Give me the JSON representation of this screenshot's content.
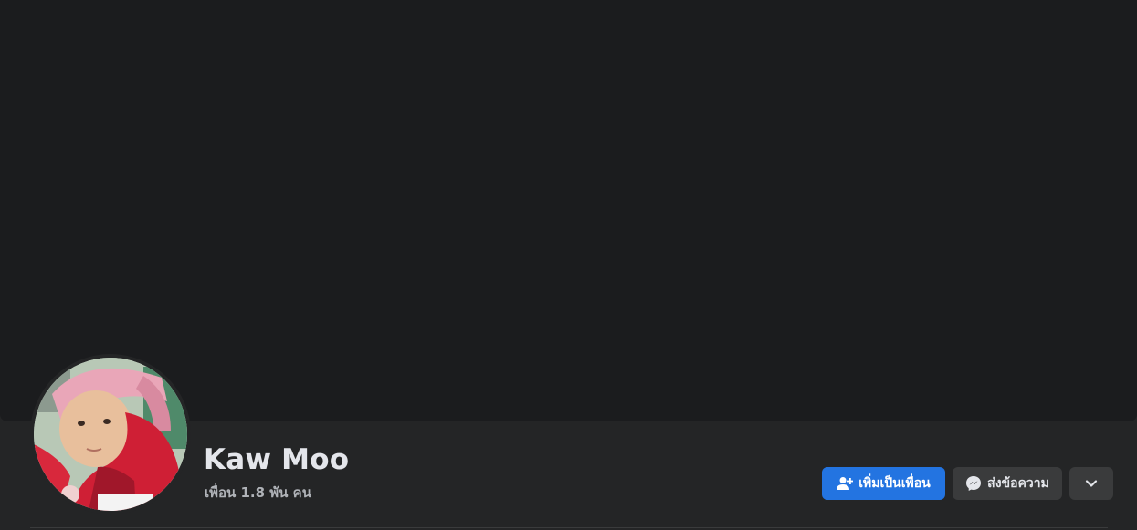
{
  "profile": {
    "name": "Kaw Moo",
    "friends": "เพื่อน 1.8 พัน คน"
  },
  "actions": {
    "add_friend_label": "เพิ่มเป็นเพื่อน",
    "message_label": "ส่งข้อความ",
    "more_icon": "chevron-down-icon",
    "add_friend_icon": "add-friend-icon",
    "message_icon": "messenger-icon"
  },
  "colors": {
    "page_bg": "#242526",
    "cover_bg": "#1b1c1e",
    "primary": "#2374e1",
    "secondary_button": "#3a3b3c",
    "text_primary": "#e4e6eb",
    "text_secondary": "#b0b3b8"
  }
}
